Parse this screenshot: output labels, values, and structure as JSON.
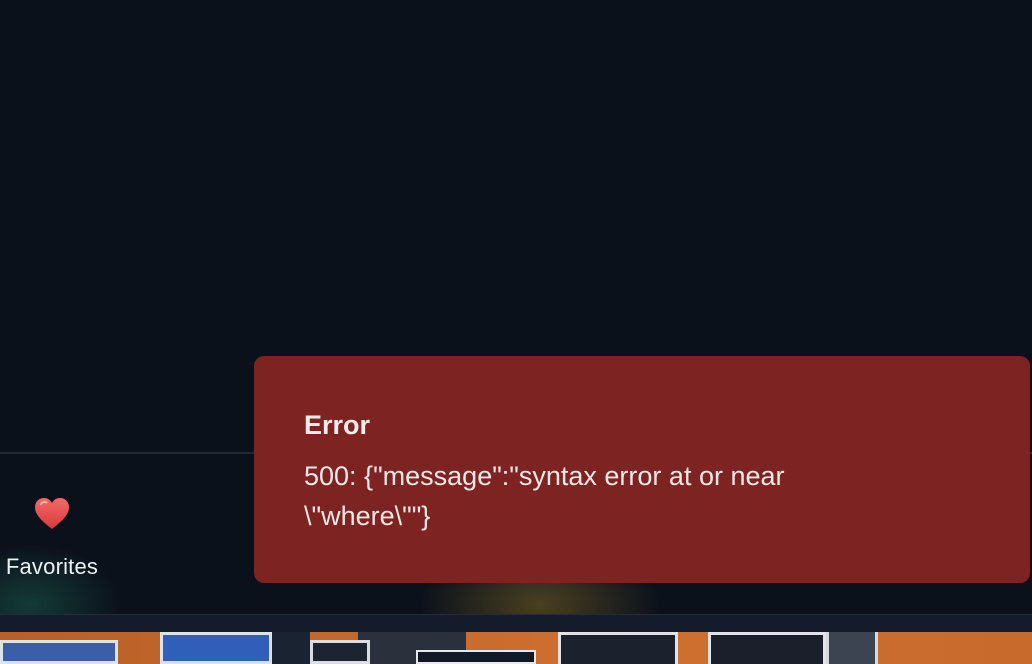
{
  "dock": {
    "favorites": {
      "label": "Favorites",
      "icon": "heart-icon"
    }
  },
  "toast": {
    "title": "Error",
    "message": "500: {\"message\":\"syntax error at or near \\\"where\\\"\"}"
  },
  "colors": {
    "background": "#0b111b",
    "toast_background": "#7d2423",
    "heart": "#e5484d"
  }
}
